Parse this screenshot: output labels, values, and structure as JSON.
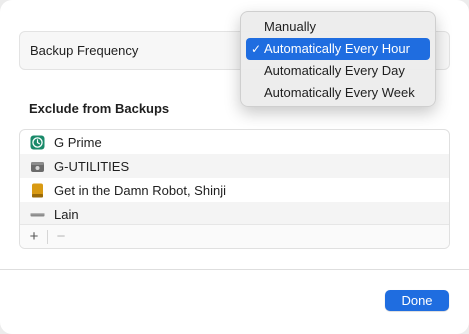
{
  "frequency": {
    "label": "Backup Frequency",
    "options": [
      {
        "label": "Manually",
        "selected": false
      },
      {
        "label": "Automatically Every Hour",
        "selected": true
      },
      {
        "label": "Automatically Every Day",
        "selected": false
      },
      {
        "label": "Automatically Every Week",
        "selected": false
      }
    ],
    "check_glyph": "✓"
  },
  "exclude": {
    "title": "Exclude from Backups",
    "items": [
      {
        "label": "G Prime",
        "icon": "time-machine-drive-icon"
      },
      {
        "label": "G-UTILITIES",
        "icon": "external-drive-icon"
      },
      {
        "label": "Get in the Damn Robot, Shinji",
        "icon": "folder-drive-icon"
      },
      {
        "label": "Lain",
        "icon": "thin-drive-icon"
      }
    ],
    "add_label": "+",
    "remove_label": "−"
  },
  "done_label": "Done",
  "colors": {
    "accent": "#1f6de0",
    "time_machine_green": "#1a8a6a",
    "drive_gray": "#6b6b6b",
    "drive_orange": "#d99a12"
  }
}
